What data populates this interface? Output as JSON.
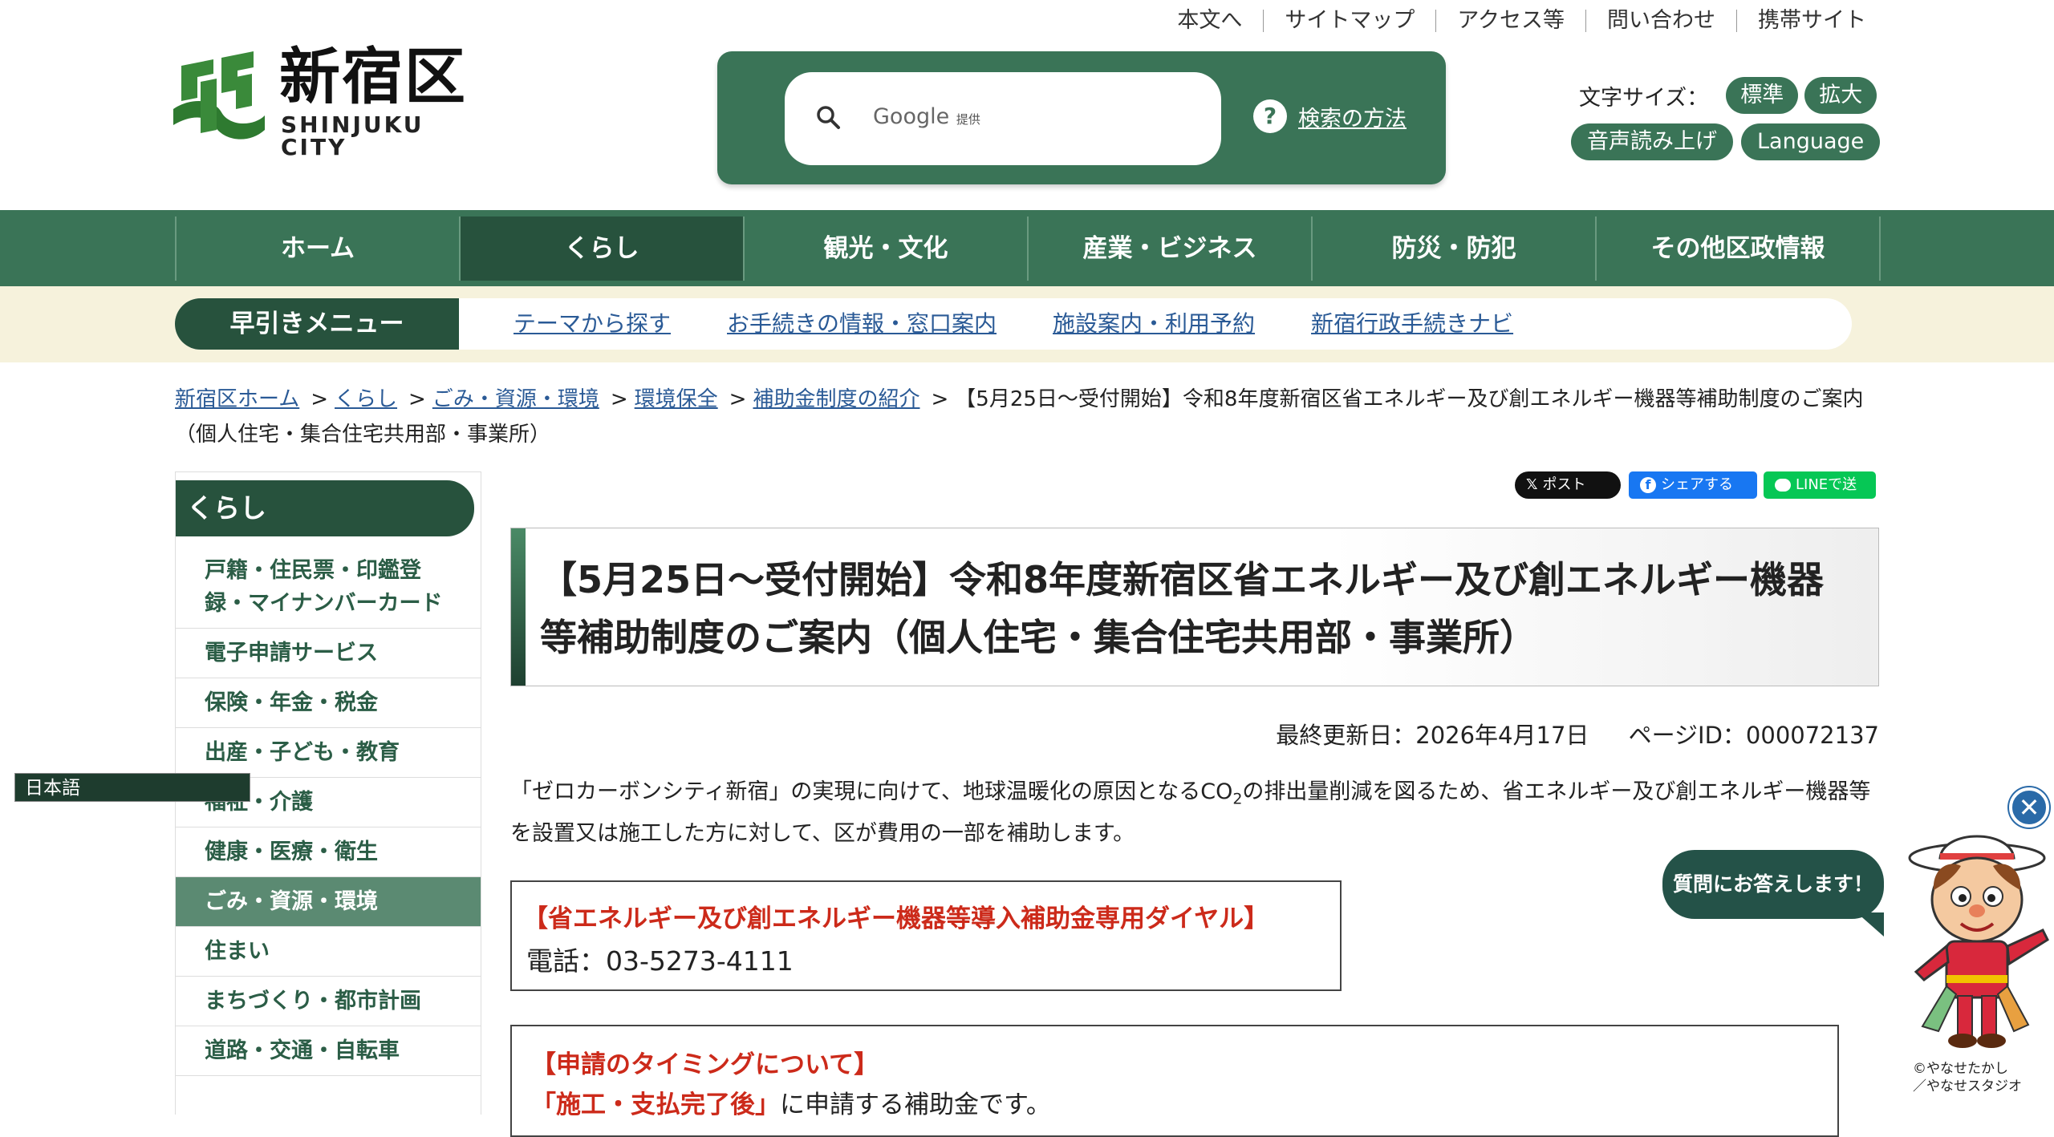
{
  "util_links": [
    "本文へ",
    "サイトマップ",
    "アクセス等",
    "問い合わせ",
    "携帯サイト"
  ],
  "logo": {
    "title": "新宿区",
    "subtitle": "SHINJUKU CITY"
  },
  "search": {
    "google_label": "Google",
    "provided": "提供",
    "help_label": "検索の方法",
    "help_icon": "?"
  },
  "text_size": {
    "label": "文字サイズ：",
    "standard": "標準",
    "large": "拡大"
  },
  "voice_label": "音声読み上げ",
  "language_label": "Language",
  "main_nav": [
    {
      "label": "ホーム",
      "active": false
    },
    {
      "label": "くらし",
      "active": true
    },
    {
      "label": "観光・文化",
      "active": false
    },
    {
      "label": "産業・ビジネス",
      "active": false
    },
    {
      "label": "防災・防犯",
      "active": false
    },
    {
      "label": "その他区政情報",
      "active": false
    }
  ],
  "quick_menu": {
    "title": "早引きメニュー",
    "links": [
      "テーマから探す",
      "お手続きの情報・窓口案内",
      "施設案内・利用予約",
      "新宿行政手続きナビ"
    ]
  },
  "breadcrumb": {
    "links": [
      "新宿区ホーム",
      "くらし",
      "ごみ・資源・環境",
      "環境保全",
      "補助金制度の紹介"
    ],
    "separator": ">",
    "current": "【5月25日～受付開始】令和8年度新宿区省エネルギー及び創エネルギー機器等補助制度のご案内（個人住宅・集合住宅共用部・事業所）"
  },
  "sidebar": {
    "heading": "くらし",
    "items": [
      {
        "label": "戸籍・住民票・印鑑登録・マイナンバーカード",
        "active": false
      },
      {
        "label": "電子申請サービス",
        "active": false
      },
      {
        "label": "保険・年金・税金",
        "active": false
      },
      {
        "label": "出産・子ども・教育",
        "active": false
      },
      {
        "label": "福祉・介護",
        "active": false
      },
      {
        "label": "健康・医療・衛生",
        "active": false
      },
      {
        "label": "ごみ・資源・環境",
        "active": true
      },
      {
        "label": "住まい",
        "active": false
      },
      {
        "label": "まちづくり・都市計画",
        "active": false
      },
      {
        "label": "道路・交通・自転車",
        "active": false
      }
    ]
  },
  "language_select": {
    "value": "日本語"
  },
  "share": {
    "x": "ポスト",
    "x_mark": "𝕏",
    "facebook": "シェアする",
    "facebook_mark": "f",
    "line": "LINEで送る"
  },
  "page": {
    "title": "【5月25日～受付開始】令和8年度新宿区省エネルギー及び創エネルギー機器等補助制度のご案内（個人住宅・集合住宅共用部・事業所）",
    "updated": "最終更新日：2026年4月17日",
    "page_id": "ページID：000072137",
    "intro_pre": "「ゼロカーボンシティ新宿」の実現に向けて、地球温暖化の原因となるCO",
    "intro_sub": "2",
    "intro_post": "の排出量削減を図るため、省エネルギー及び創エネルギー機器等を設置又は施工した方に対して、区が費用の一部を補助します。",
    "dial_heading": "【省エネルギー及び創エネルギー機器等導入補助金専用ダイヤル】",
    "dial_tel": "電話：03-5273-4111",
    "timing_heading": "【申請のタイミングについて】",
    "timing_emph": "「施工・支払完了後」",
    "timing_rest": "に申請する補助金です。"
  },
  "chatbot": {
    "close_icon": "✕",
    "bubble": "質問にお答えします！",
    "credit_1": "©やなせたかし",
    "credit_2": "／やなせスタジオ"
  },
  "colors": {
    "brand_green": "#3a7457",
    "dark_green": "#27523d",
    "link_blue": "#2a5a96",
    "alert_red": "#cc2a1a",
    "quick_bar_bg": "#f6f2dc"
  }
}
